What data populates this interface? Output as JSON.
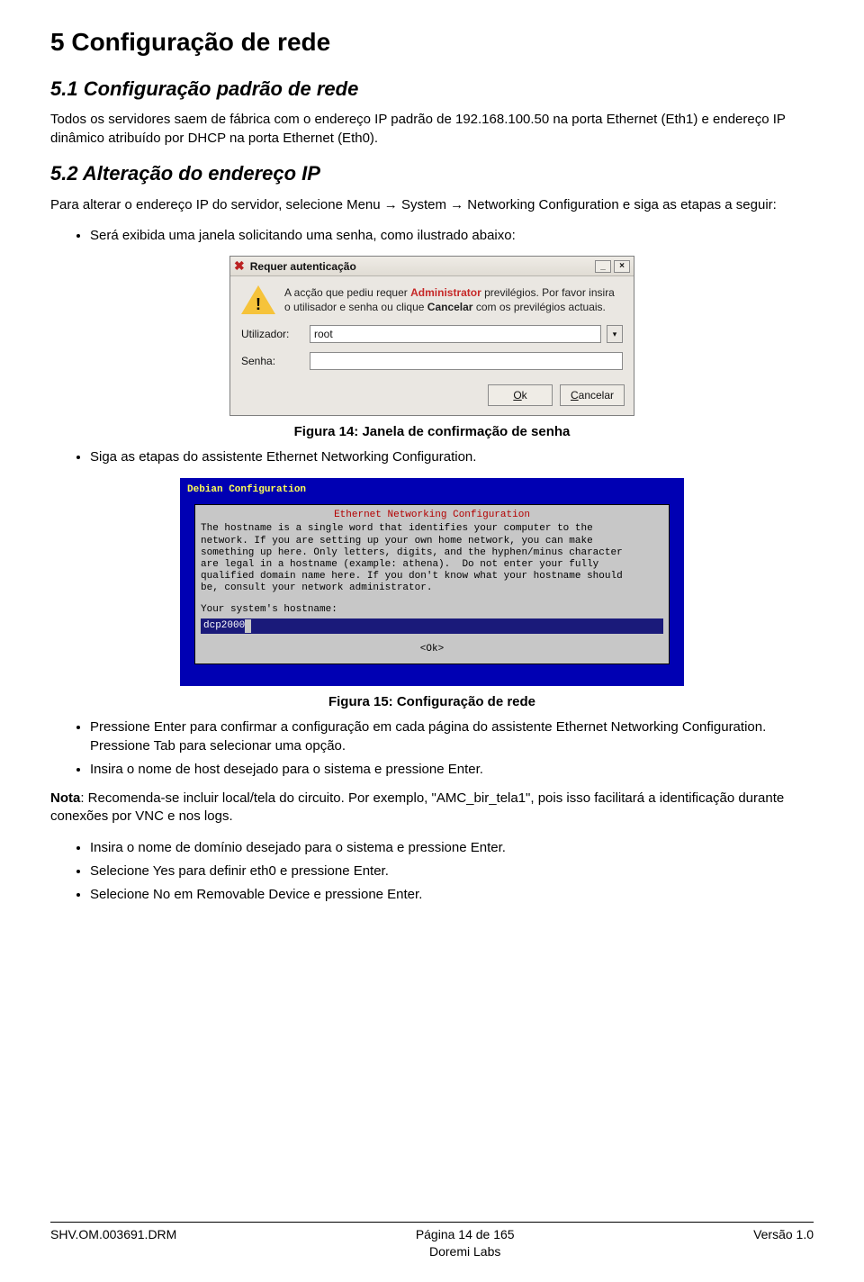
{
  "h1": "5  Configuração de rede",
  "s51": {
    "title": "5.1  Configuração padrão de rede",
    "para": "Todos os servidores saem de fábrica com o endereço IP padrão de 192.168.100.50 na porta Ethernet (Eth1) e endereço IP dinâmico atribuído por DHCP na porta Ethernet (Eth0)."
  },
  "s52": {
    "title": "5.2  Alteração do endereço IP",
    "para": "Para alterar o endereço IP do servidor, selecione Menu → System → Networking Configuration e siga as etapas a seguir:",
    "bullet1": "Será exibida uma janela solicitando uma senha, como ilustrado abaixo:"
  },
  "dlg1": {
    "title": "Requer autenticação",
    "msg_pre": "A acção que pediu requer ",
    "msg_admin": "Administrator",
    "msg_post1": " previlégios. Por favor insira o utilisador e senha ou clique ",
    "msg_cancel": "Cancelar",
    "msg_post2": " com os previlégios actuais.",
    "user_label": "Utilizador:",
    "user_value": "root",
    "pass_label": "Senha:",
    "ok": "Ok",
    "cancel": "Cancelar"
  },
  "fig14": "Figura 14: Janela de confirmação de senha",
  "bullet2": "Siga as etapas do assistente Ethernet Networking Configuration.",
  "deb": {
    "title": "Debian Configuration",
    "heading": "Ethernet Networking Configuration",
    "body": "The hostname is a single word that identifies your computer to the\nnetwork. If you are setting up your own home network, you can make\nsomething up here. Only letters, digits, and the hyphen/minus character\nare legal in a hostname (example: athena).  Do not enter your fully\nqualified domain name here. If you don't know what your hostname should\nbe, consult your network administrator.",
    "prompt": "Your system's hostname:",
    "value": "dcp2000",
    "ok": "<Ok>"
  },
  "fig15": "Figura 15: Configuração de rede",
  "bullets_after": [
    "Pressione Enter para confirmar a configuração em cada página do assistente Ethernet Networking Configuration. Pressione Tab para selecionar uma opção.",
    "Insira o nome de host desejado para o sistema e pressione Enter."
  ],
  "nota_label": "Nota",
  "nota_text": ": Recomenda-se incluir local/tela do circuito. Por exemplo, \"AMC_bir_tela1\", pois isso facilitará a identificação durante conexões por VNC e nos logs.",
  "bullets_final": [
    "Insira o nome de domínio desejado para o sistema e pressione Enter.",
    "Selecione Yes para definir eth0 e pressione Enter.",
    "Selecione No em Removable Device e pressione Enter."
  ],
  "footer": {
    "left": "SHV.OM.003691.DRM",
    "center1": "Página 14 de 165",
    "center2": "Doremi Labs",
    "right": "Versão 1.0"
  }
}
